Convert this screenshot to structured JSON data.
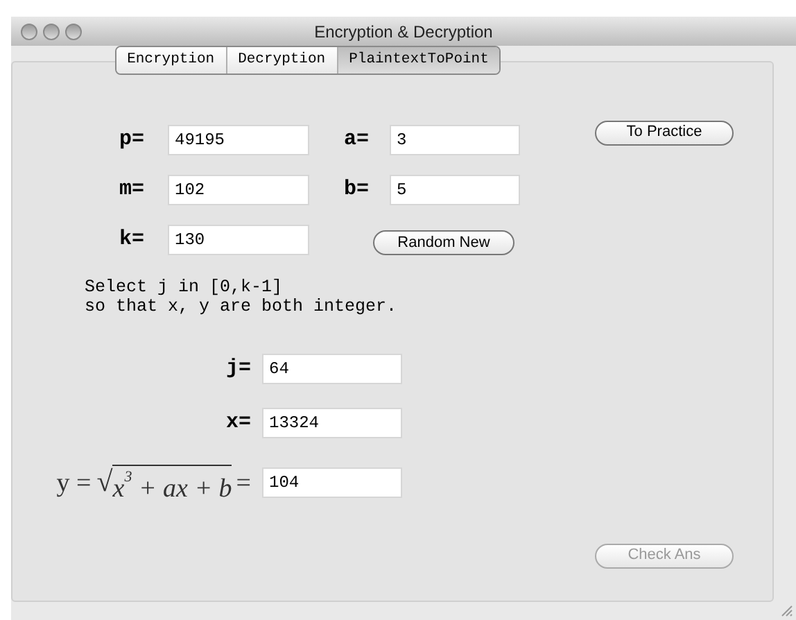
{
  "window": {
    "title": "Encryption & Decryption"
  },
  "tabs": [
    {
      "label": "Encryption",
      "selected": false
    },
    {
      "label": "Decryption",
      "selected": false
    },
    {
      "label": "PlaintextToPoint",
      "selected": true
    }
  ],
  "params": [
    [
      {
        "label": "p=",
        "value": "49195"
      },
      {
        "label": "a=",
        "value": "3"
      }
    ],
    [
      {
        "label": "m=",
        "value": "102"
      },
      {
        "label": "b=",
        "value": "5"
      }
    ],
    [
      {
        "label": "k=",
        "value": "130"
      }
    ]
  ],
  "to_practice_button": {
    "label": "To Practice",
    "disabled": false
  },
  "random_new_button": {
    "label": "Random New",
    "disabled": false
  },
  "instruction": [
    "Select j in [0,k-1]",
    "so that x, y are both integer."
  ],
  "j_field": {
    "label": "j=",
    "value": "64"
  },
  "x_field": {
    "label": "x=",
    "value": "13324"
  },
  "y_field": {
    "lhs": "y =",
    "radical": "√",
    "radicand": "x$^{3}$ + ax + b",
    "rhs": "=",
    "value": "104"
  },
  "check_button": {
    "label": "Check Ans",
    "disabled": true
  }
}
